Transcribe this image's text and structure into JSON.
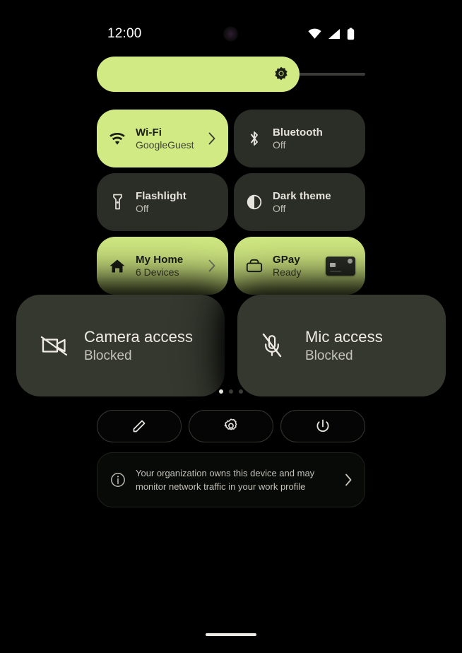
{
  "status_bar": {
    "clock": "12:00",
    "icons": [
      "wifi-icon",
      "cell-signal-icon",
      "battery-icon"
    ],
    "punch_hole": "front-camera-punch-hole"
  },
  "brightness": {
    "label": "Brightness",
    "icon": "brightness-sun-icon",
    "level_percent": 75,
    "fill_color": "#d2ea83",
    "track_color": "#3b3b38"
  },
  "tiles": [
    {
      "id": "wifi",
      "icon": "wifi-icon",
      "title": "Wi-Fi",
      "subtitle": "GoogleGuest",
      "active": true,
      "chevron": true,
      "extra": null
    },
    {
      "id": "bluetooth",
      "icon": "bluetooth-icon",
      "title": "Bluetooth",
      "subtitle": "Off",
      "active": false,
      "chevron": false,
      "extra": null
    },
    {
      "id": "flashlight",
      "icon": "flashlight-icon",
      "title": "Flashlight",
      "subtitle": "Off",
      "active": false,
      "chevron": false,
      "extra": null
    },
    {
      "id": "dark-theme",
      "icon": "contrast-icon",
      "title": "Dark theme",
      "subtitle": "Off",
      "active": false,
      "chevron": false,
      "extra": null
    },
    {
      "id": "my-home",
      "icon": "home-icon",
      "title": "My Home",
      "subtitle": "6 Devices",
      "active": true,
      "chevron": true,
      "extra": null
    },
    {
      "id": "gpay",
      "icon": "wallet-icon",
      "title": "GPay",
      "subtitle": "Ready",
      "active": true,
      "chevron": false,
      "extra": "payment-card-thumbnail"
    }
  ],
  "privacy_overlays": [
    {
      "id": "camera-access",
      "icon": "camera-off-icon",
      "title": "Camera access",
      "subtitle": "Blocked"
    },
    {
      "id": "mic-access",
      "icon": "mic-off-icon",
      "title": "Mic access",
      "subtitle": "Blocked"
    }
  ],
  "page_indicator": {
    "count": 3,
    "active_index": 0
  },
  "footer_buttons": [
    {
      "id": "edit",
      "icon": "pencil-icon",
      "label": "Edit tiles"
    },
    {
      "id": "settings",
      "icon": "gear-icon",
      "label": "Settings"
    },
    {
      "id": "power",
      "icon": "power-icon",
      "label": "Power"
    }
  ],
  "org_banner": {
    "icon": "info-icon",
    "line1": "Your organization owns this device and may",
    "line2": "monitor network traffic in your work profile",
    "chevron": "chevron-right-icon"
  },
  "colors": {
    "background": "#000000",
    "accent": "#d2ea83",
    "tile_inactive": "#2b2e27",
    "overlay_card": "#35382f",
    "text_primary": "#e6e3dc",
    "text_secondary": "#bfbdb4"
  },
  "home_bar": "gesture-home-indicator"
}
